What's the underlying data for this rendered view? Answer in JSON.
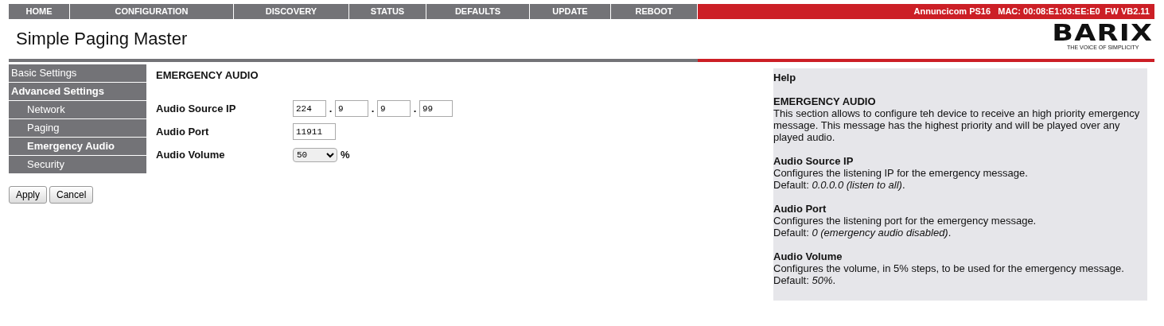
{
  "top_nav": [
    {
      "label": "HOME"
    },
    {
      "label": "CONFIGURATION"
    },
    {
      "label": "DISCOVERY"
    },
    {
      "label": "STATUS"
    },
    {
      "label": "DEFAULTS"
    },
    {
      "label": "UPDATE"
    },
    {
      "label": "REBOOT"
    }
  ],
  "device_info": "Annuncicom PS16   MAC: 00:08:E1:03:EE:E0  FW VB2.11",
  "page_title": "Simple Paging Master",
  "logo": {
    "name": "BARIX",
    "tagline": "THE VOICE OF SIMPLICITY"
  },
  "sidebar": {
    "items": [
      {
        "label": "Basic Settings",
        "expanded": false
      },
      {
        "label": "Advanced Settings",
        "expanded": true,
        "children": [
          {
            "label": "Network",
            "selected": false
          },
          {
            "label": "Paging",
            "selected": false
          },
          {
            "label": "Emergency Audio",
            "selected": true
          },
          {
            "label": "Security",
            "selected": false
          }
        ]
      }
    ]
  },
  "buttons": [
    "Apply",
    "Cancel"
  ],
  "form": {
    "title": "EMERGENCY AUDIO",
    "fields": [
      {
        "kind": "ip",
        "label": "Audio Source IP",
        "values": [
          "224",
          "9",
          "9",
          "99"
        ],
        "separator": "."
      },
      {
        "kind": "text",
        "label": "Audio Port",
        "value": "11911"
      },
      {
        "kind": "select",
        "label": "Audio Volume",
        "value": "50",
        "unit": "%"
      }
    ]
  },
  "help": {
    "title": "Help",
    "sections": [
      {
        "heading": "EMERGENCY AUDIO",
        "lines": [
          "This section allows to configure teh device to receive an high priority emergency message. This message has the highest priority and will be played over any played audio."
        ]
      },
      {
        "heading": "Audio Source IP",
        "lines": [
          "Configures the listening IP for the emergency message.",
          "Default: *0.0.0.0 (listen to all)*."
        ]
      },
      {
        "heading": "Audio Port",
        "lines": [
          "Configures the listening port for the emergency message.",
          "Default: *0 (emergency audio disabled)*."
        ]
      },
      {
        "heading": "Audio Volume",
        "lines": [
          "Configures the volume, in 5% steps, to be used for the emergency message.",
          "Default: *50%*."
        ]
      }
    ]
  }
}
